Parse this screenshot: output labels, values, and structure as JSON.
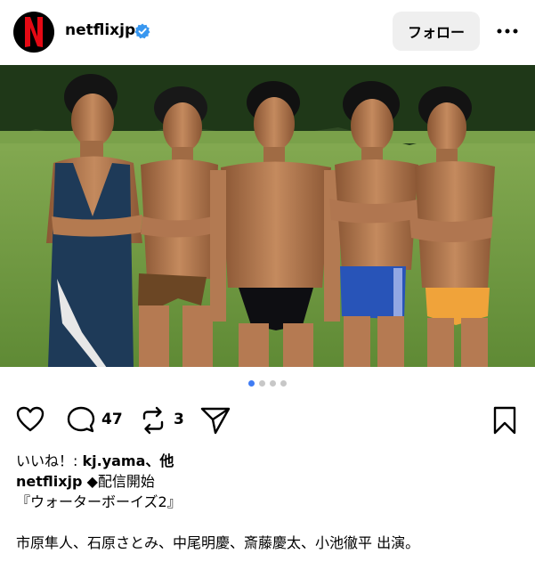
{
  "post": {
    "username": "netflixjp",
    "follow_label": "フォロー",
    "likes_count": "47",
    "reposts_count": "3",
    "active_slide": 1,
    "slide_count": 4
  },
  "caption": {
    "likes_prefix": "いいね！: ",
    "likes_user": "kj.yama",
    "likes_suffix": "、他",
    "author": "netflixjp",
    "line1_text": " ◆配信開始",
    "line2_text": "『ウォーターボーイズ2』",
    "line3_text": "市原隼人、石原さとみ、中尾明慶、斎藤慶太、小池徹平 出演。"
  },
  "colors": {
    "verified_blue": "#3897f0",
    "netflix_red": "#e50914",
    "dot_active": "#3f7cf4"
  }
}
